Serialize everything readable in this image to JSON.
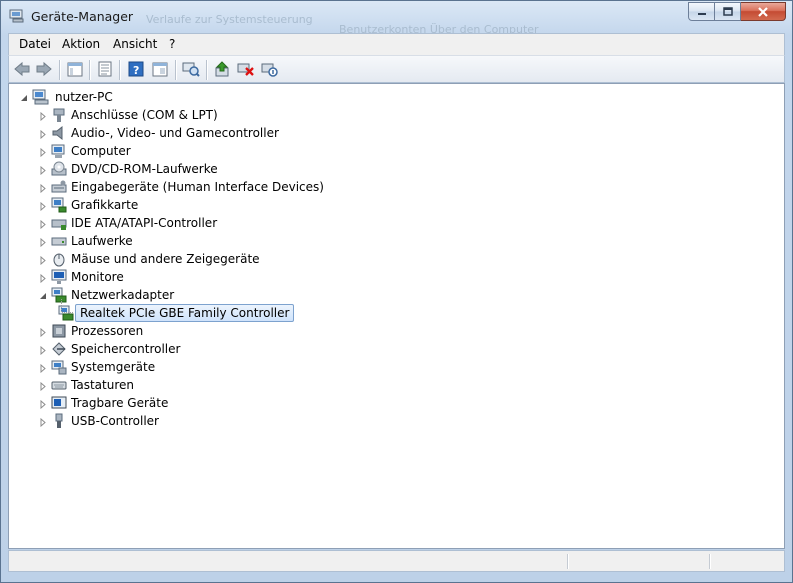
{
  "window": {
    "title": "Geräte-Manager",
    "ghost_texts": [
      "Verlaufe zur Systemsteuerung",
      "Benutzerkonten Über den Computer"
    ]
  },
  "menu": [
    "Datei",
    "Aktion",
    "Ansicht",
    "?"
  ],
  "toolbar_icons": [
    "back-arrow-icon",
    "forward-arrow-icon",
    "show-hide-console-tree-icon",
    "properties-sheet-icon",
    "help-icon",
    "console-view-icon",
    "scan-hardware-icon",
    "update-driver-icon",
    "uninstall-device-icon",
    "disable-device-icon"
  ],
  "tree": {
    "root": "nutzer-PC",
    "categories": [
      {
        "label": "Anschlüsse (COM & LPT)",
        "icon": "port-icon",
        "expanded": false
      },
      {
        "label": "Audio-, Video- und Gamecontroller",
        "icon": "speaker-icon",
        "expanded": false
      },
      {
        "label": "Computer",
        "icon": "computer-icon",
        "expanded": false
      },
      {
        "label": "DVD/CD-ROM-Laufwerke",
        "icon": "dvd-drive-icon",
        "expanded": false
      },
      {
        "label": "Eingabegeräte (Human Interface Devices)",
        "icon": "hid-icon",
        "expanded": false
      },
      {
        "label": "Grafikkarte",
        "icon": "display-adapter-icon",
        "expanded": false
      },
      {
        "label": "IDE ATA/ATAPI-Controller",
        "icon": "ide-controller-icon",
        "expanded": false
      },
      {
        "label": "Laufwerke",
        "icon": "disk-drive-icon",
        "expanded": false
      },
      {
        "label": "Mäuse und andere Zeigegeräte",
        "icon": "mouse-icon",
        "expanded": false
      },
      {
        "label": "Monitore",
        "icon": "monitor-icon",
        "expanded": false
      },
      {
        "label": "Netzwerkadapter",
        "icon": "network-adapter-icon",
        "expanded": true,
        "children": [
          {
            "label": "Realtek PCIe GBE Family Controller",
            "icon": "network-adapter-icon",
            "selected": true
          }
        ]
      },
      {
        "label": "Prozessoren",
        "icon": "processor-icon",
        "expanded": false
      },
      {
        "label": "Speichercontroller",
        "icon": "storage-controller-icon",
        "expanded": false
      },
      {
        "label": "Systemgeräte",
        "icon": "system-device-icon",
        "expanded": false
      },
      {
        "label": "Tastaturen",
        "icon": "keyboard-icon",
        "expanded": false
      },
      {
        "label": "Tragbare Geräte",
        "icon": "portable-device-icon",
        "expanded": false
      },
      {
        "label": "USB-Controller",
        "icon": "usb-icon",
        "expanded": false
      }
    ]
  },
  "colors": {
    "selection_border": "#7da2ce",
    "selection_fill": "#cfe3fb",
    "window_frame": "#bdd1e8"
  }
}
